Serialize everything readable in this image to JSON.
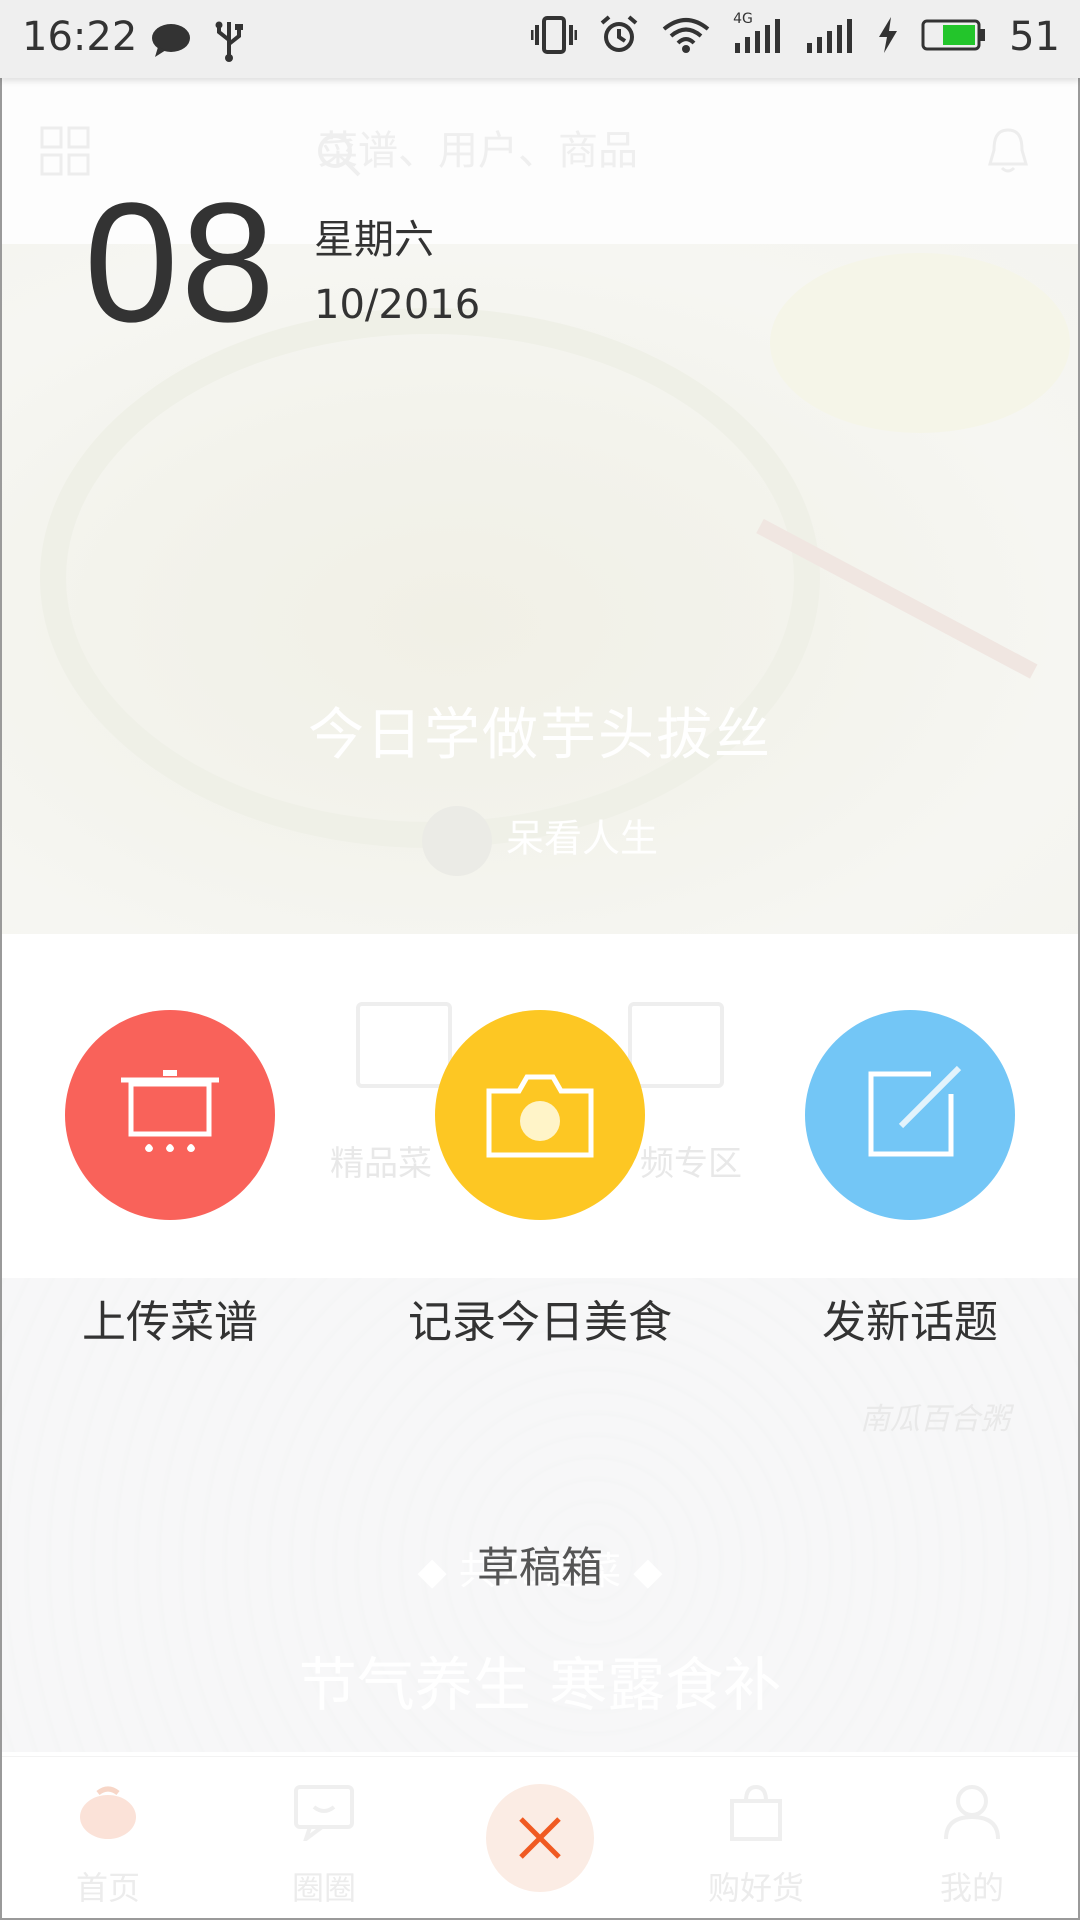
{
  "status_bar": {
    "time": "16:22",
    "battery_percent": "51",
    "network_label": "4G",
    "battery_color": "#23c52b",
    "icons": [
      "chat-bubble-icon",
      "usb-icon",
      "vibrate-icon",
      "alarm-icon",
      "wifi-icon",
      "signal-4g-icon",
      "signal-icon",
      "charging-icon",
      "battery-icon"
    ]
  },
  "background": {
    "search_placeholder": "菜谱、用户、商品",
    "featured_title": "今日学做芋头拔丝",
    "featured_author": "呆看人生",
    "category_labels": [
      "精品菜",
      "频专区"
    ],
    "photo_signature": "南瓜百合粥",
    "banner_count": "◆ 共75道菜 ◆",
    "banner_title": "节气养生 寒露食补"
  },
  "date": {
    "day": "08",
    "weekday": "星期六",
    "month_year": "10/2016"
  },
  "actions": [
    {
      "label": "上传菜谱",
      "color": "#f9625a",
      "icon": "pot-icon"
    },
    {
      "label": "记录今日美食",
      "color": "#fdc723",
      "icon": "camera-icon"
    },
    {
      "label": "发新话题",
      "color": "#73c6f6",
      "icon": "compose-icon"
    }
  ],
  "drafts_label": "草稿箱",
  "bottom_nav": {
    "items": [
      {
        "label": "首页",
        "icon": "home-icon"
      },
      {
        "label": "圈圈",
        "icon": "chat-icon"
      },
      {
        "label": "购好货",
        "icon": "shopping-bag-icon"
      },
      {
        "label": "我的",
        "icon": "profile-icon"
      }
    ],
    "close_icon": "close-icon",
    "close_color": "#f05a22"
  }
}
